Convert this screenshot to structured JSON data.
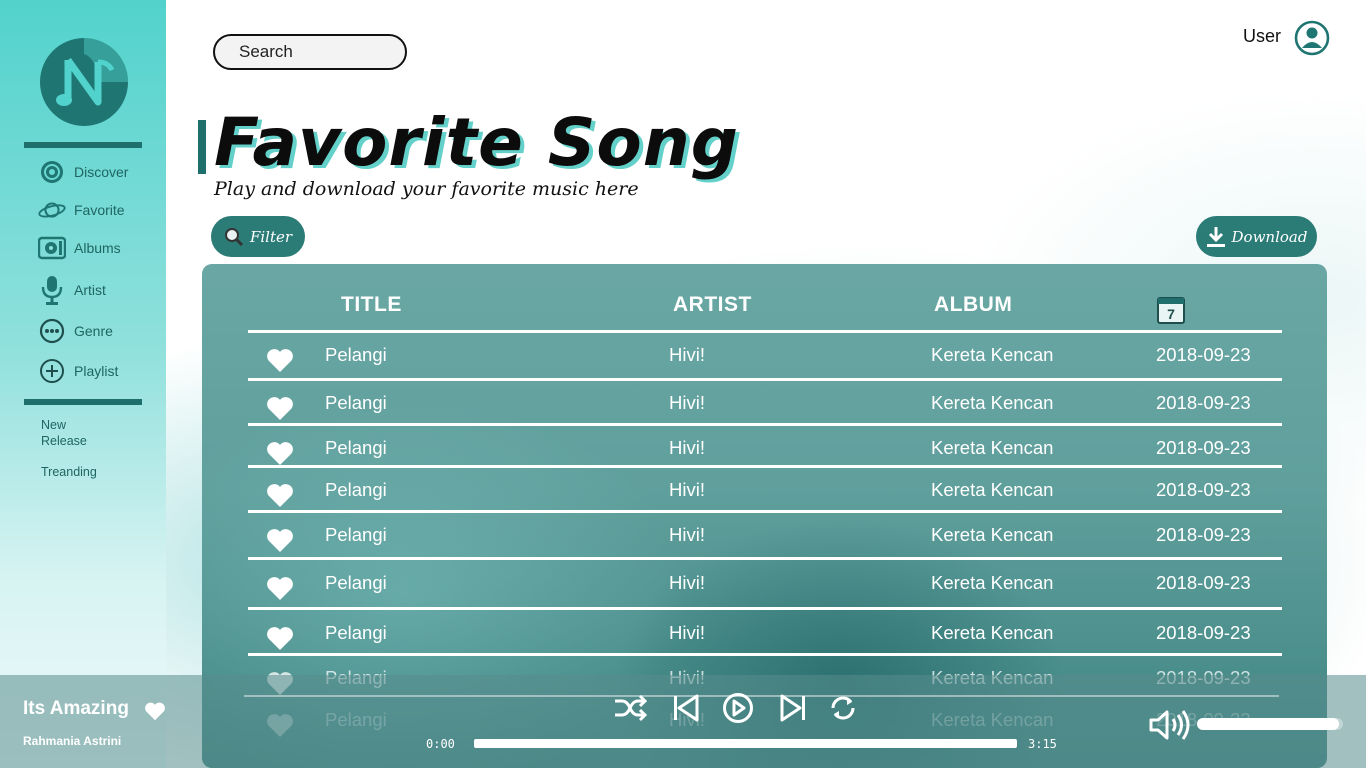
{
  "sidebar": {
    "nav": [
      {
        "label": "Discover",
        "icon": "disc-icon"
      },
      {
        "label": "Favorite",
        "icon": "planet-icon"
      },
      {
        "label": "Albums",
        "icon": "album-icon"
      },
      {
        "label": "Artist",
        "icon": "microphone-icon"
      },
      {
        "label": "Genre",
        "icon": "more-dots-icon"
      },
      {
        "label": "Playlist",
        "icon": "plus-circle-icon"
      }
    ],
    "links": {
      "new_release_line1": "New",
      "new_release_line2": "Release",
      "trending": "Treanding"
    }
  },
  "header": {
    "search_placeholder": "Search",
    "user_label": "User"
  },
  "page": {
    "title": "Favorite Song",
    "subtitle": "Play and download your favorite music here",
    "filter_label": "Filter",
    "download_label": "Download"
  },
  "table": {
    "columns": {
      "title": "TITLE",
      "artist": "ARTIST",
      "album": "ALBUM",
      "date_icon_text": "7"
    },
    "rows": [
      {
        "title": "Pelangi",
        "artist": "Hivi!",
        "album": "Kereta Kencan",
        "date": "2018-09-23"
      },
      {
        "title": "Pelangi",
        "artist": "Hivi!",
        "album": "Kereta Kencan",
        "date": "2018-09-23"
      },
      {
        "title": "Pelangi",
        "artist": "Hivi!",
        "album": "Kereta Kencan",
        "date": "2018-09-23"
      },
      {
        "title": "Pelangi",
        "artist": "Hivi!",
        "album": "Kereta Kencan",
        "date": "2018-09-23"
      },
      {
        "title": "Pelangi",
        "artist": "Hivi!",
        "album": "Kereta Kencan",
        "date": "2018-09-23"
      },
      {
        "title": "Pelangi",
        "artist": "Hivi!",
        "album": "Kereta Kencan",
        "date": "2018-09-23"
      },
      {
        "title": "Pelangi",
        "artist": "Hivi!",
        "album": "Kereta Kencan",
        "date": "2018-09-23"
      },
      {
        "title": "Pelangi",
        "artist": "Hivi!",
        "album": "Kereta Kencan",
        "date": "2018-09-23"
      },
      {
        "title": "Pelangi",
        "artist": "Hivi!",
        "album": "Kereta Kencan",
        "date": "2018-09-23"
      }
    ]
  },
  "player": {
    "song_title": "Its Amazing",
    "artist": "Rahmania Astrini",
    "time_current": "0:00",
    "time_total": "3:15",
    "progress": 0.0,
    "volume": 0.97,
    "controls": [
      "shuffle-icon",
      "previous-icon",
      "play-icon",
      "next-icon",
      "repeat-icon"
    ]
  },
  "colors": {
    "accent": "#2b7b77",
    "sidebar_top": "#52d2cc",
    "title_shadow": "#63d1c9"
  }
}
